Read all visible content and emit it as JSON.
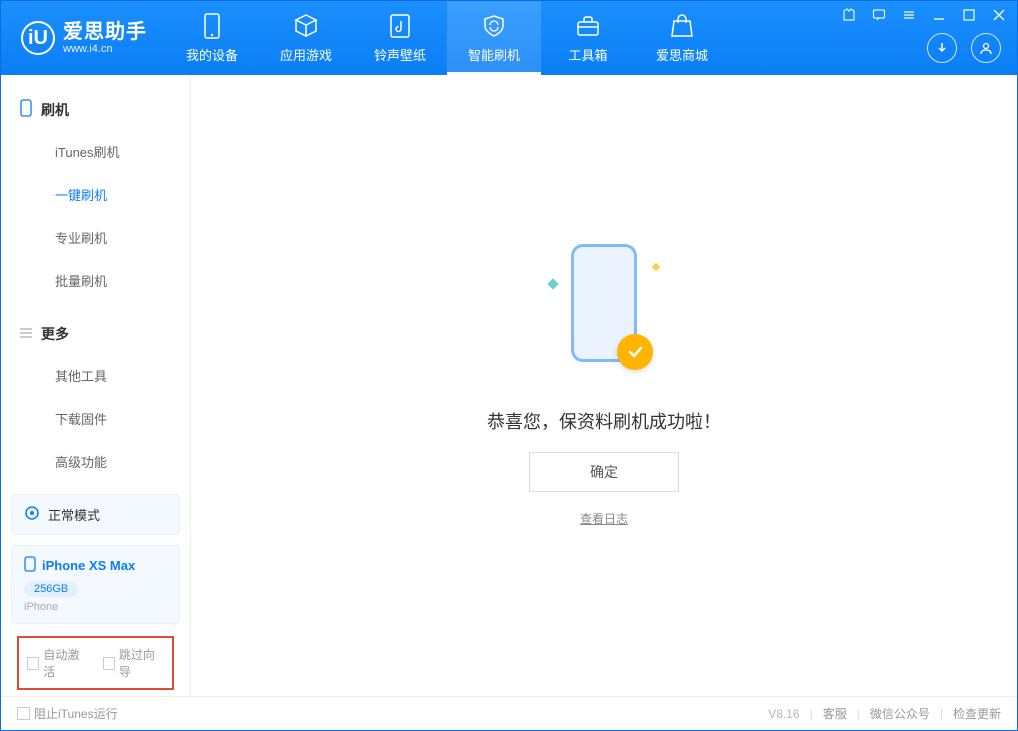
{
  "app": {
    "title": "爱思助手",
    "site": "www.i4.cn"
  },
  "nav": {
    "items": [
      {
        "label": "我的设备"
      },
      {
        "label": "应用游戏"
      },
      {
        "label": "铃声壁纸"
      },
      {
        "label": "智能刷机"
      },
      {
        "label": "工具箱"
      },
      {
        "label": "爱思商城"
      }
    ]
  },
  "sidebar": {
    "group1": {
      "title": "刷机",
      "items": [
        "iTunes刷机",
        "一键刷机",
        "专业刷机",
        "批量刷机"
      ],
      "active_index": 1
    },
    "group2": {
      "title": "更多",
      "items": [
        "其他工具",
        "下载固件",
        "高级功能"
      ]
    },
    "status": "正常模式",
    "device": {
      "name": "iPhone XS Max",
      "storage": "256GB",
      "type": "iPhone"
    },
    "checkboxes": {
      "auto_activate": "自动激活",
      "skip_wizard": "跳过向导"
    }
  },
  "main": {
    "success_text": "恭喜您，保资料刷机成功啦！",
    "ok_button": "确定",
    "log_link": "查看日志"
  },
  "footer": {
    "block_itunes": "阻止iTunes运行",
    "version": "V8.16",
    "links": [
      "客服",
      "微信公众号",
      "检查更新"
    ]
  }
}
